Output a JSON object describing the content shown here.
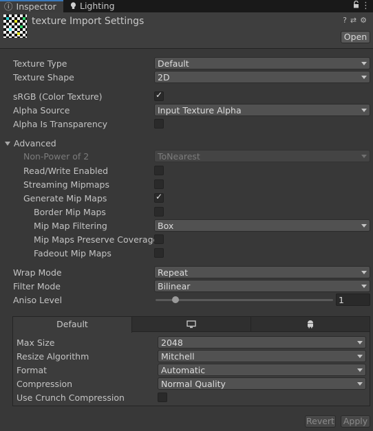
{
  "tabs": [
    {
      "label": "Inspector",
      "icon": "info-icon",
      "active": true
    },
    {
      "label": "Lighting",
      "icon": "bulb-icon",
      "active": false
    }
  ],
  "header": {
    "title": "texture Import Settings",
    "open_label": "Open",
    "icons": [
      "help-icon",
      "preset-icon",
      "gear-icon"
    ]
  },
  "fields": {
    "texture_type": {
      "label": "Texture Type",
      "value": "Default"
    },
    "texture_shape": {
      "label": "Texture Shape",
      "value": "2D"
    },
    "srgb": {
      "label": "sRGB (Color Texture)",
      "checked": true
    },
    "alpha_source": {
      "label": "Alpha Source",
      "value": "Input Texture Alpha"
    },
    "alpha_transparency": {
      "label": "Alpha Is Transparency",
      "checked": false
    }
  },
  "advanced": {
    "label": "Advanced",
    "npot": {
      "label": "Non-Power of 2",
      "value": "ToNearest",
      "disabled": true
    },
    "read_write": {
      "label": "Read/Write Enabled",
      "checked": false
    },
    "streaming": {
      "label": "Streaming Mipmaps",
      "checked": false
    },
    "gen_mips": {
      "label": "Generate Mip Maps",
      "checked": true
    },
    "border_mips": {
      "label": "Border Mip Maps",
      "checked": false
    },
    "mip_filter": {
      "label": "Mip Map Filtering",
      "value": "Box"
    },
    "preserve_cov": {
      "label": "Mip Maps Preserve Coverage",
      "checked": false
    },
    "fadeout": {
      "label": "Fadeout Mip Maps",
      "checked": false
    }
  },
  "wrap": {
    "label": "Wrap Mode",
    "value": "Repeat"
  },
  "filter": {
    "label": "Filter Mode",
    "value": "Bilinear"
  },
  "aniso": {
    "label": "Aniso Level",
    "value": "1",
    "min": 0,
    "max": 16
  },
  "platform": {
    "tabs": [
      {
        "label": "Default",
        "icon": null,
        "active": true
      },
      {
        "label": "",
        "icon": "monitor-icon",
        "active": false
      },
      {
        "label": "",
        "icon": "android-icon",
        "active": false
      }
    ],
    "max_size": {
      "label": "Max Size",
      "value": "2048"
    },
    "resize": {
      "label": "Resize Algorithm",
      "value": "Mitchell"
    },
    "format": {
      "label": "Format",
      "value": "Automatic"
    },
    "compression": {
      "label": "Compression",
      "value": "Normal Quality"
    },
    "crunch": {
      "label": "Use Crunch Compression",
      "checked": false
    }
  },
  "footer": {
    "revert_label": "Revert",
    "apply_label": "Apply"
  },
  "colors": {
    "accent": "#3a79bb",
    "background": "#383838"
  }
}
